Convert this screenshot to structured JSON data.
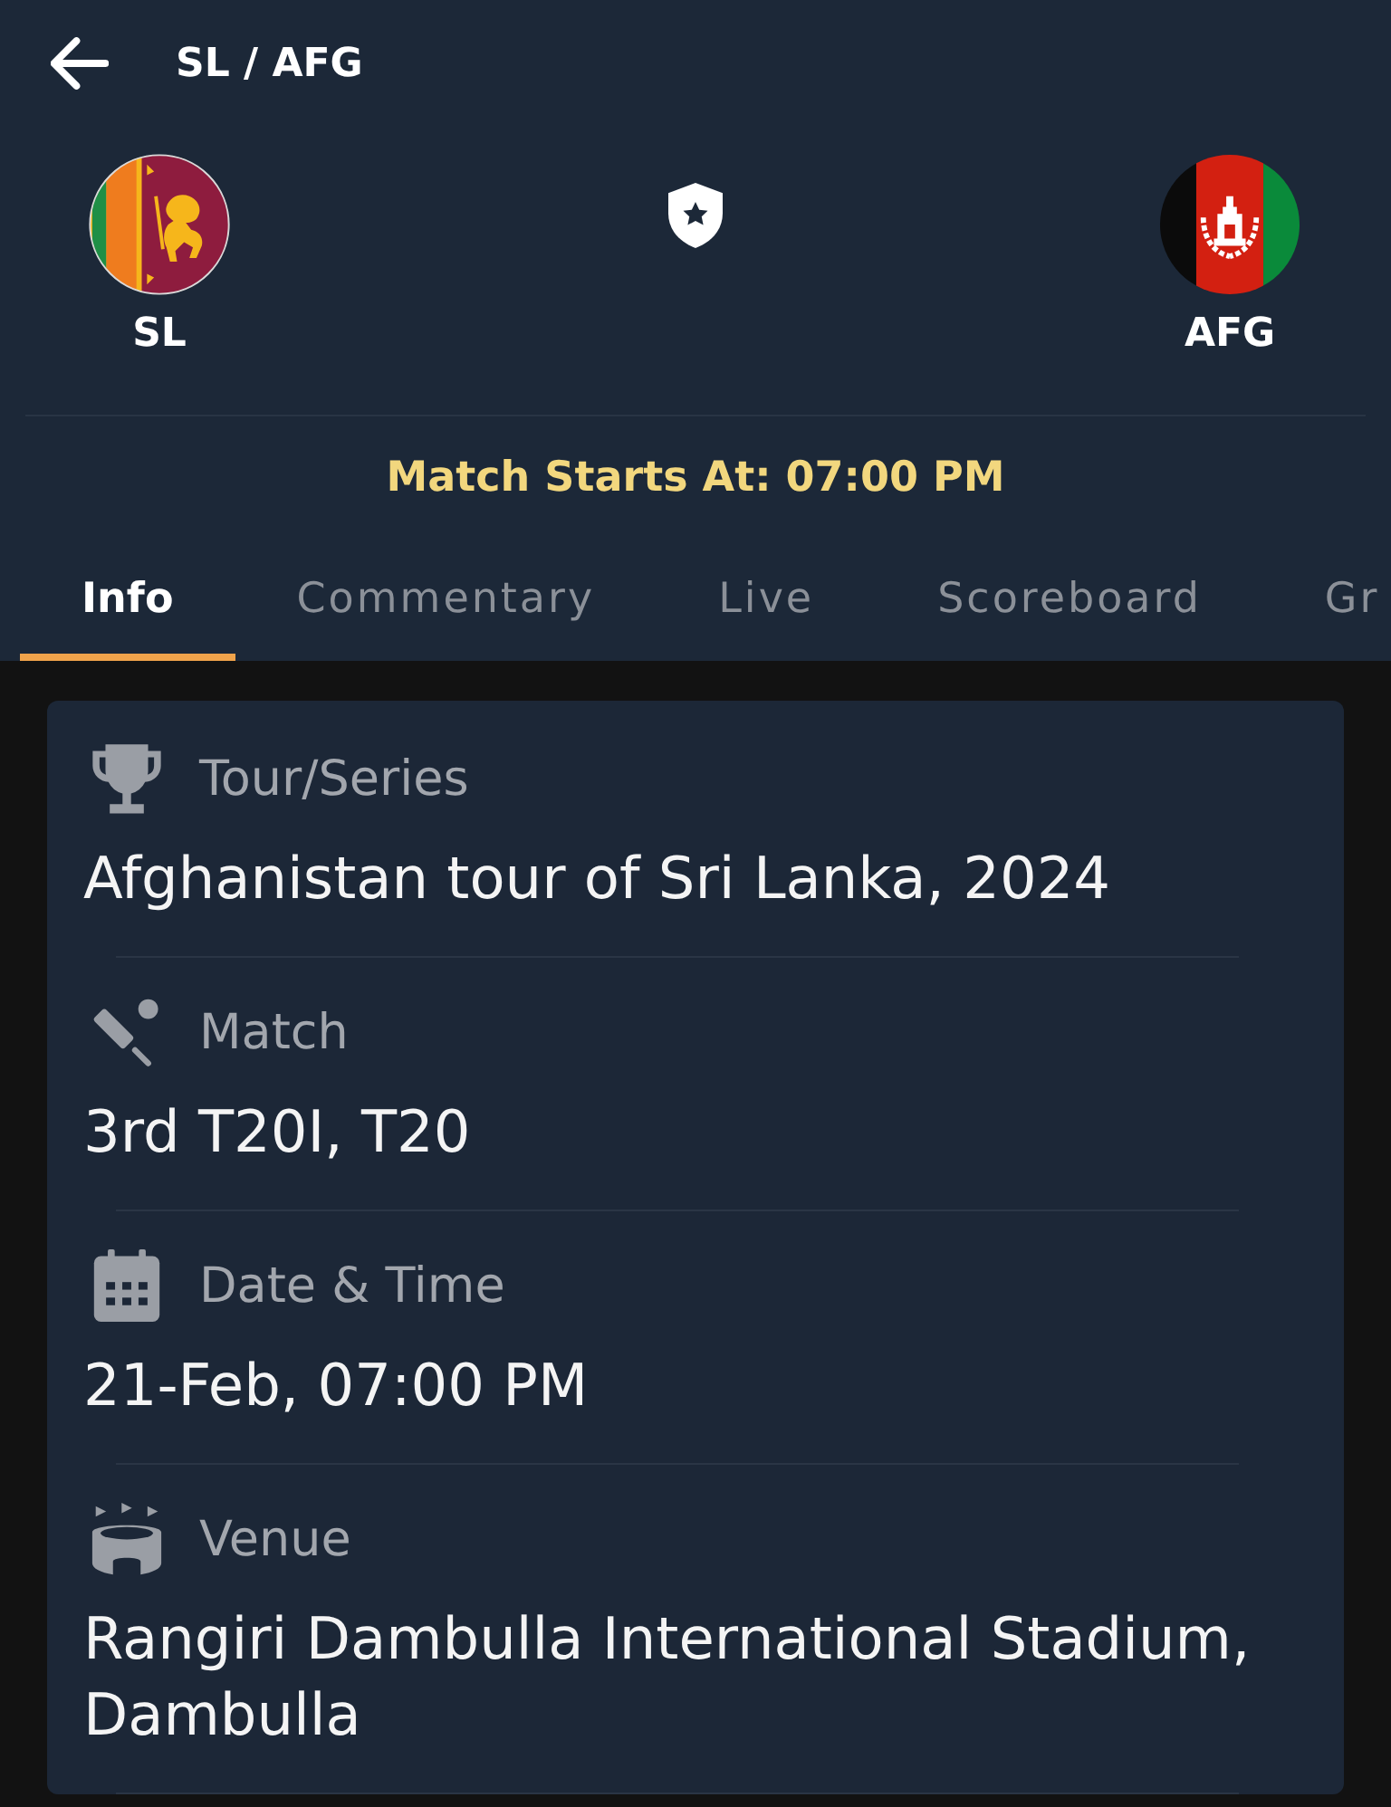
{
  "header": {
    "title": "SL / AFG"
  },
  "teams": {
    "home": {
      "name": "SL"
    },
    "away": {
      "name": "AFG"
    }
  },
  "match_start": "Match Starts At: 07:00 PM",
  "tabs": [
    {
      "label": "Info",
      "selected": true
    },
    {
      "label": "Commentary",
      "selected": false
    },
    {
      "label": "Live",
      "selected": false
    },
    {
      "label": "Scoreboard",
      "selected": false
    },
    {
      "label": "Gr",
      "selected": false
    }
  ],
  "info": [
    {
      "kind": "series",
      "label": "Tour/Series",
      "value": "Afghanistan tour of Sri Lanka, 2024"
    },
    {
      "kind": "match",
      "label": "Match",
      "value": "3rd T20I, T20"
    },
    {
      "kind": "datetime",
      "label": "Date & Time",
      "value": "21-Feb, 07:00 PM"
    },
    {
      "kind": "venue",
      "label": "Venue",
      "value": "Rangiri Dambulla International Stadium, Dambulla"
    }
  ]
}
